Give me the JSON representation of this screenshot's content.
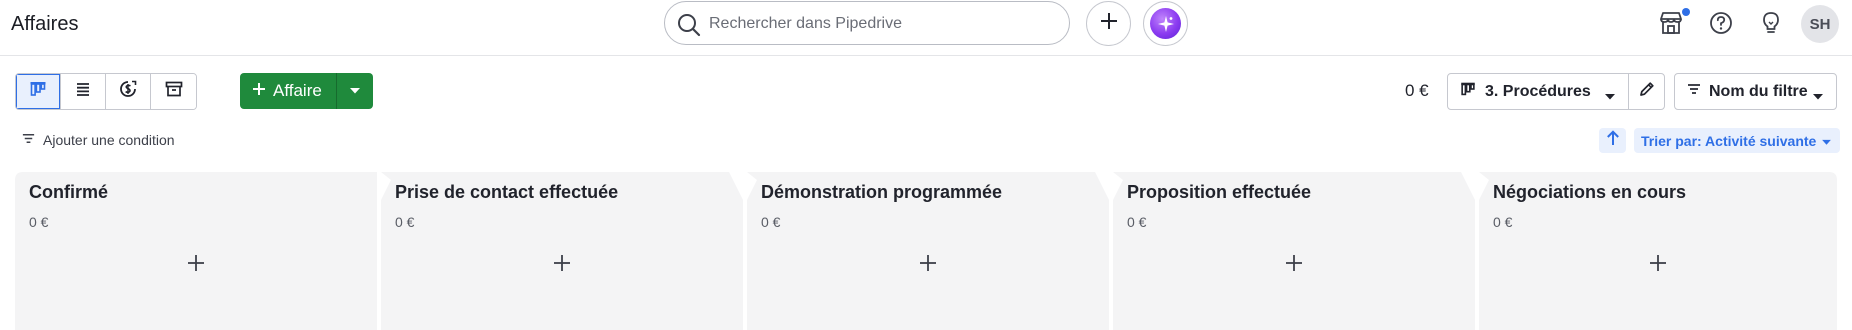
{
  "header": {
    "title": "Affaires",
    "search_placeholder": "Rechercher dans Pipedrive",
    "avatar_initials": "SH"
  },
  "toolbar": {
    "add_deal_label": "Affaire",
    "total_amount": "0 €",
    "pipeline_label": "3. Procédures",
    "filter_label": "Nom du filtre"
  },
  "conditions": {
    "add_condition_label": "Ajouter une condition",
    "sort_label": "Trier par: Activité suivante"
  },
  "stages": [
    {
      "title": "Confirmé",
      "amount": "0 €"
    },
    {
      "title": "Prise de contact effectuée",
      "amount": "0 €"
    },
    {
      "title": "Démonstration programmée",
      "amount": "0 €"
    },
    {
      "title": "Proposition effectuée",
      "amount": "0 €"
    },
    {
      "title": "Négociations en cours",
      "amount": "0 €"
    }
  ],
  "colors": {
    "accent": "#2f6fe6",
    "add_button": "#1f8a3c",
    "stage_bg": "#f4f4f5"
  }
}
